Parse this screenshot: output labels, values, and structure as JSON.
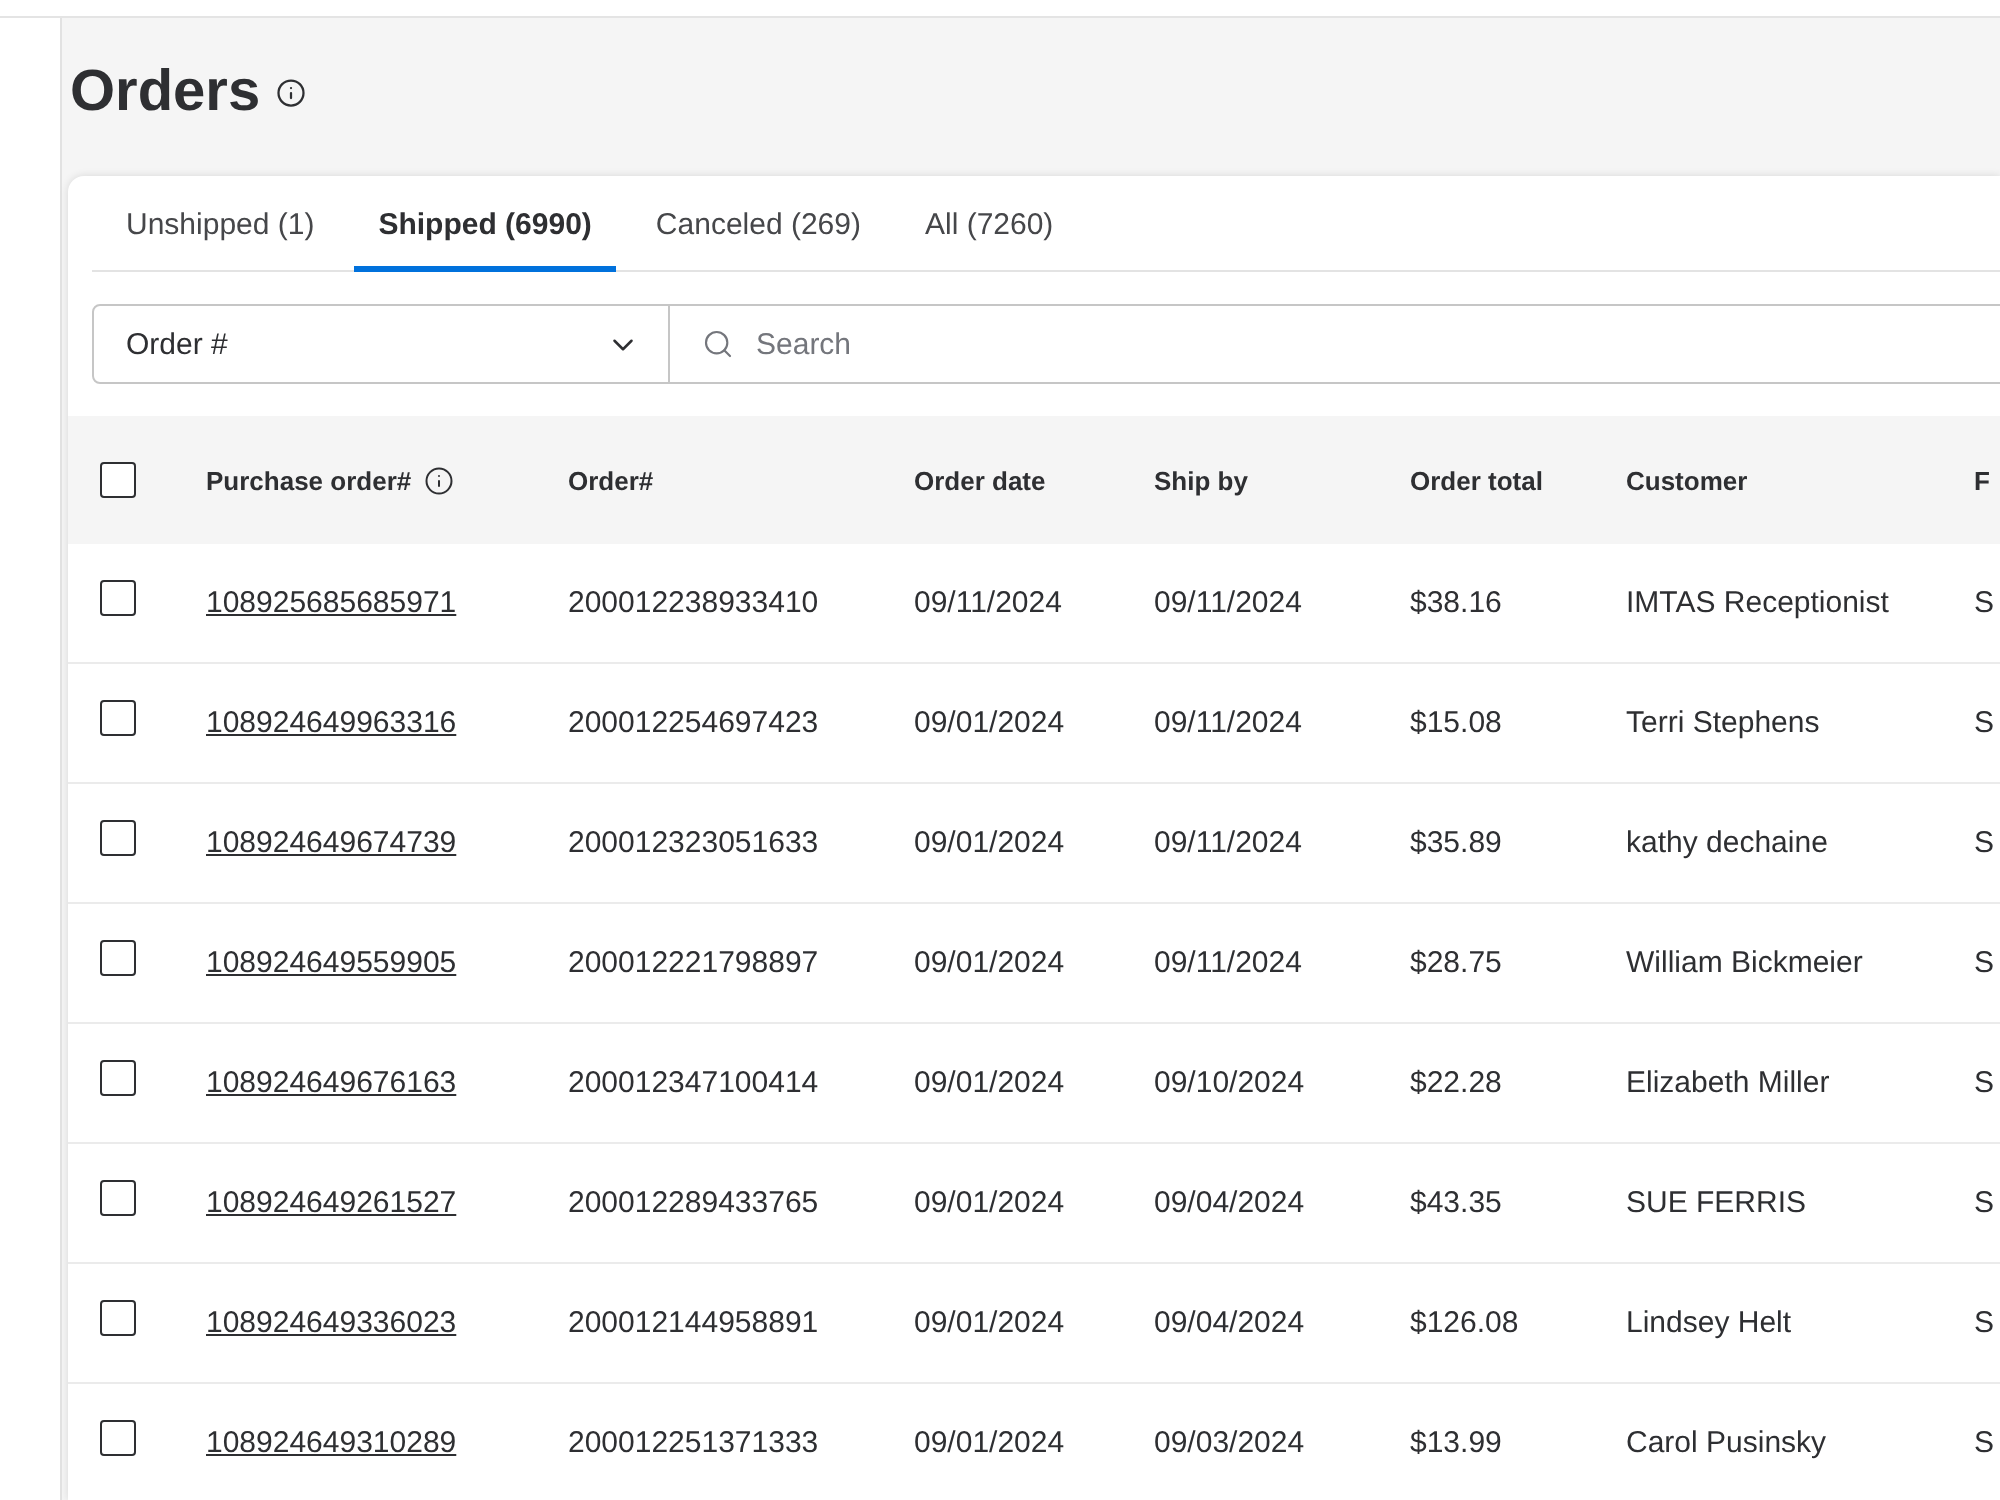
{
  "page": {
    "title": "Orders"
  },
  "tabs": [
    {
      "label": "Unshipped (1)",
      "selected": false
    },
    {
      "label": "Shipped (6990)",
      "selected": true
    },
    {
      "label": "Canceled (269)",
      "selected": false
    },
    {
      "label": "All (7260)",
      "selected": false
    }
  ],
  "filter": {
    "field": "Order #",
    "search_placeholder": "Search"
  },
  "table": {
    "select_all": {
      "checked": false
    },
    "columns": [
      {
        "label": "Purchase order#",
        "kind": "link",
        "info": true
      },
      {
        "label": "Order#",
        "kind": "text",
        "info": false
      },
      {
        "label": "Order date",
        "kind": "text",
        "info": false
      },
      {
        "label": "Ship by",
        "kind": "text",
        "info": false
      },
      {
        "label": "Order total",
        "kind": "text",
        "info": false
      },
      {
        "label": "Customer",
        "kind": "text",
        "info": false
      },
      {
        "label": "F",
        "kind": "text",
        "info": false
      }
    ],
    "rows": [
      {
        "checked": false,
        "cells": [
          "108925685685971",
          "200012238933410",
          "09/11/2024",
          "09/11/2024",
          "$38.16",
          "IMTAS Receptionist",
          "S"
        ]
      },
      {
        "checked": false,
        "cells": [
          "108924649963316",
          "200012254697423",
          "09/01/2024",
          "09/11/2024",
          "$15.08",
          "Terri Stephens",
          "S"
        ]
      },
      {
        "checked": false,
        "cells": [
          "108924649674739",
          "200012323051633",
          "09/01/2024",
          "09/11/2024",
          "$35.89",
          "kathy dechaine",
          "S"
        ]
      },
      {
        "checked": false,
        "cells": [
          "108924649559905",
          "200012221798897",
          "09/01/2024",
          "09/11/2024",
          "$28.75",
          "William Bickmeier",
          "S"
        ]
      },
      {
        "checked": false,
        "cells": [
          "108924649676163",
          "200012347100414",
          "09/01/2024",
          "09/10/2024",
          "$22.28",
          "Elizabeth Miller",
          "S"
        ]
      },
      {
        "checked": false,
        "cells": [
          "108924649261527",
          "200012289433765",
          "09/01/2024",
          "09/04/2024",
          "$43.35",
          "SUE FERRIS",
          "S"
        ]
      },
      {
        "checked": false,
        "cells": [
          "108924649336023",
          "200012144958891",
          "09/01/2024",
          "09/04/2024",
          "$126.08",
          "Lindsey Helt",
          "S"
        ]
      },
      {
        "checked": false,
        "cells": [
          "108924649310289",
          "200012251371333",
          "09/01/2024",
          "09/03/2024",
          "$13.99",
          "Carol Pusinsky",
          "S"
        ]
      }
    ]
  }
}
